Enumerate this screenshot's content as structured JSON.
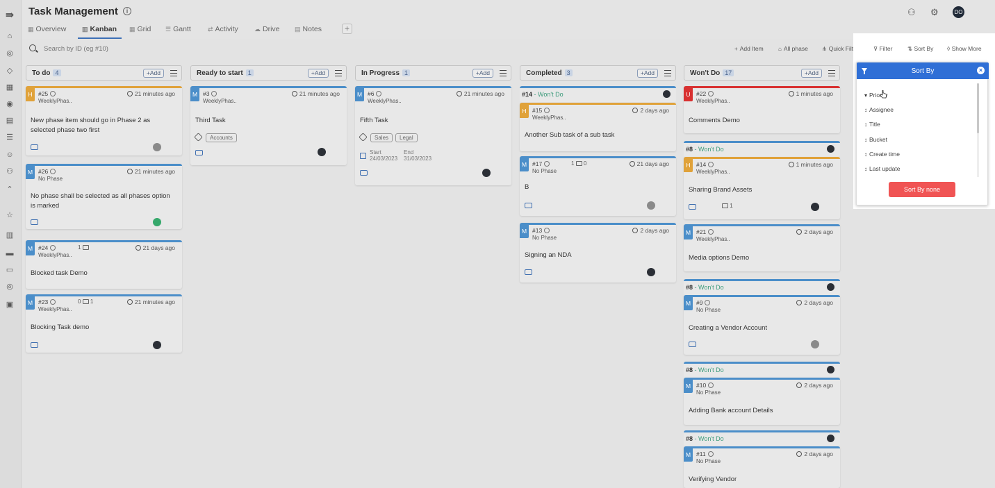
{
  "header": {
    "title": "Task Management",
    "avatar_initials": "DO"
  },
  "tabs": [
    {
      "label": "Overview"
    },
    {
      "label": "Kanban"
    },
    {
      "label": "Grid"
    },
    {
      "label": "Gantt"
    },
    {
      "label": "Activity"
    },
    {
      "label": "Drive"
    },
    {
      "label": "Notes"
    }
  ],
  "search": {
    "placeholder": "Search by ID (eg #10)"
  },
  "toolbar": {
    "add_item": "Add Item",
    "all_phase": "All phase",
    "quick_filter": "Quick Filter",
    "filter": "Filter",
    "sort_by": "Sort By",
    "show_more": "Show More"
  },
  "columns": [
    {
      "title": "To do",
      "count": "4",
      "add": "+Add",
      "cards": [
        {
          "priority": "H",
          "id": "#25",
          "phase": "WeeklyPhas..",
          "time": "21 minutes ago",
          "title": "New phase item should go in Phase 2 as selected phase two first"
        },
        {
          "priority": "M",
          "id": "#26",
          "phase": "No Phase",
          "time": "21 minutes ago",
          "title": "No phase shall be selected as all phases option is marked"
        },
        {
          "priority": "M",
          "id": "#24",
          "sub": "1",
          "phase": "WeeklyPhas..",
          "time": "21 days ago",
          "title": "Blocked task Demo"
        },
        {
          "priority": "M",
          "id": "#23",
          "sub": "0",
          "sub2": "1",
          "phase": "WeeklyPhas..",
          "time": "21 minutes ago",
          "title": "Blocking Task demo"
        }
      ]
    },
    {
      "title": "Ready to start",
      "count": "1",
      "add": "+Add",
      "cards": [
        {
          "priority": "M",
          "id": "#3",
          "phase": "WeeklyPhas..",
          "time": "21 minutes ago",
          "title": "Third Task",
          "tags": [
            "Accounts"
          ]
        }
      ]
    },
    {
      "title": "In Progress",
      "count": "1",
      "add": "+Add",
      "cards": [
        {
          "priority": "M",
          "id": "#6",
          "phase": "WeeklyPhas..",
          "time": "21 minutes ago",
          "title": "Fifth Task",
          "tags": [
            "Sales",
            "Legal"
          ],
          "start_label": "Start",
          "start": "24/03/2023",
          "end_label": "End",
          "end": "31/03/2023"
        }
      ]
    },
    {
      "title": "Completed",
      "count": "3",
      "add": "+Add",
      "parent": {
        "id": "#14",
        "status": "- Won't Do"
      },
      "cards": [
        {
          "priority": "H",
          "id": "#15",
          "phase": "WeeklyPhas..",
          "time": "2 days ago",
          "title": "Another Sub task of a sub task"
        },
        {
          "priority": "M",
          "id": "#17",
          "sub": "1",
          "sub2": "0",
          "phase": "No Phase",
          "time": "21 days ago",
          "title": "B"
        },
        {
          "priority": "M",
          "id": "#13",
          "phase": "No Phase",
          "time": "2 days ago",
          "title": "Signing an NDA"
        }
      ]
    },
    {
      "title": "Won't Do",
      "count": "17",
      "add": "+Add",
      "cards": [
        {
          "priority": "U",
          "id": "#22",
          "phase": "WeeklyPhas..",
          "time": "1 minutes ago",
          "title": "Comments Demo"
        },
        {
          "parent_id": "#8",
          "parent_status": "- Won't Do",
          "priority": "H",
          "id": "#14",
          "phase": "WeeklyPhas..",
          "time": "1 minutes ago",
          "title": "Sharing Brand Assets",
          "sub": "1"
        },
        {
          "priority": "M",
          "id": "#21",
          "phase": "WeeklyPhas..",
          "time": "2 days ago",
          "title": "Media options Demo"
        },
        {
          "parent_id": "#8",
          "parent_status": "- Won't Do",
          "priority": "M",
          "id": "#9",
          "phase": "No Phase",
          "time": "2 days ago",
          "title": "Creating a Vendor Account"
        },
        {
          "parent_id": "#8",
          "parent_status": "- Won't Do",
          "priority": "M",
          "id": "#10",
          "phase": "No Phase",
          "time": "2 days ago",
          "title": "Adding Bank account Details"
        },
        {
          "parent_id": "#8",
          "parent_status": "- Won't Do",
          "priority": "M",
          "id": "#11",
          "phase": "No Phase",
          "time": "2 days ago",
          "title": "Verifying Vendor"
        }
      ]
    }
  ],
  "sort_panel": {
    "title": "Sort By",
    "options": [
      "Priority",
      "Assignee",
      "Title",
      "Bucket",
      "Create time",
      "Last update"
    ],
    "none_button": "Sort By none"
  },
  "colors": {
    "accent": "#2f6fd6",
    "high": "#e0a23a",
    "medium": "#4b8ec9",
    "urgent": "#d83131",
    "status_wont_do": "#3b9a7a",
    "danger_button": "#f05454"
  }
}
